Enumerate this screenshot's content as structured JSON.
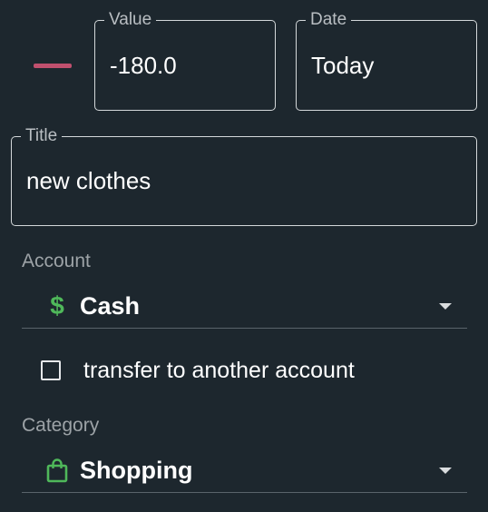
{
  "transaction_type": {
    "icon": "minus-icon",
    "color": "#c0506e"
  },
  "value_field": {
    "label": "Value",
    "value": "-180.0"
  },
  "date_field": {
    "label": "Date",
    "value": "Today"
  },
  "title_field": {
    "label": "Title",
    "value": "new clothes"
  },
  "account": {
    "label": "Account",
    "selected": "Cash",
    "icon": "dollar-icon",
    "icon_glyph": "$",
    "icon_color": "#4fb85a"
  },
  "transfer": {
    "label": "transfer to another account",
    "checked": false
  },
  "category": {
    "label": "Category",
    "selected": "Shopping",
    "icon": "shopping-bag-icon",
    "icon_color": "#4fb85a"
  },
  "colors": {
    "background": "#1d272e",
    "text": "#ffffff",
    "muted_text": "#9da3a7",
    "outline": "#d4d8da"
  }
}
